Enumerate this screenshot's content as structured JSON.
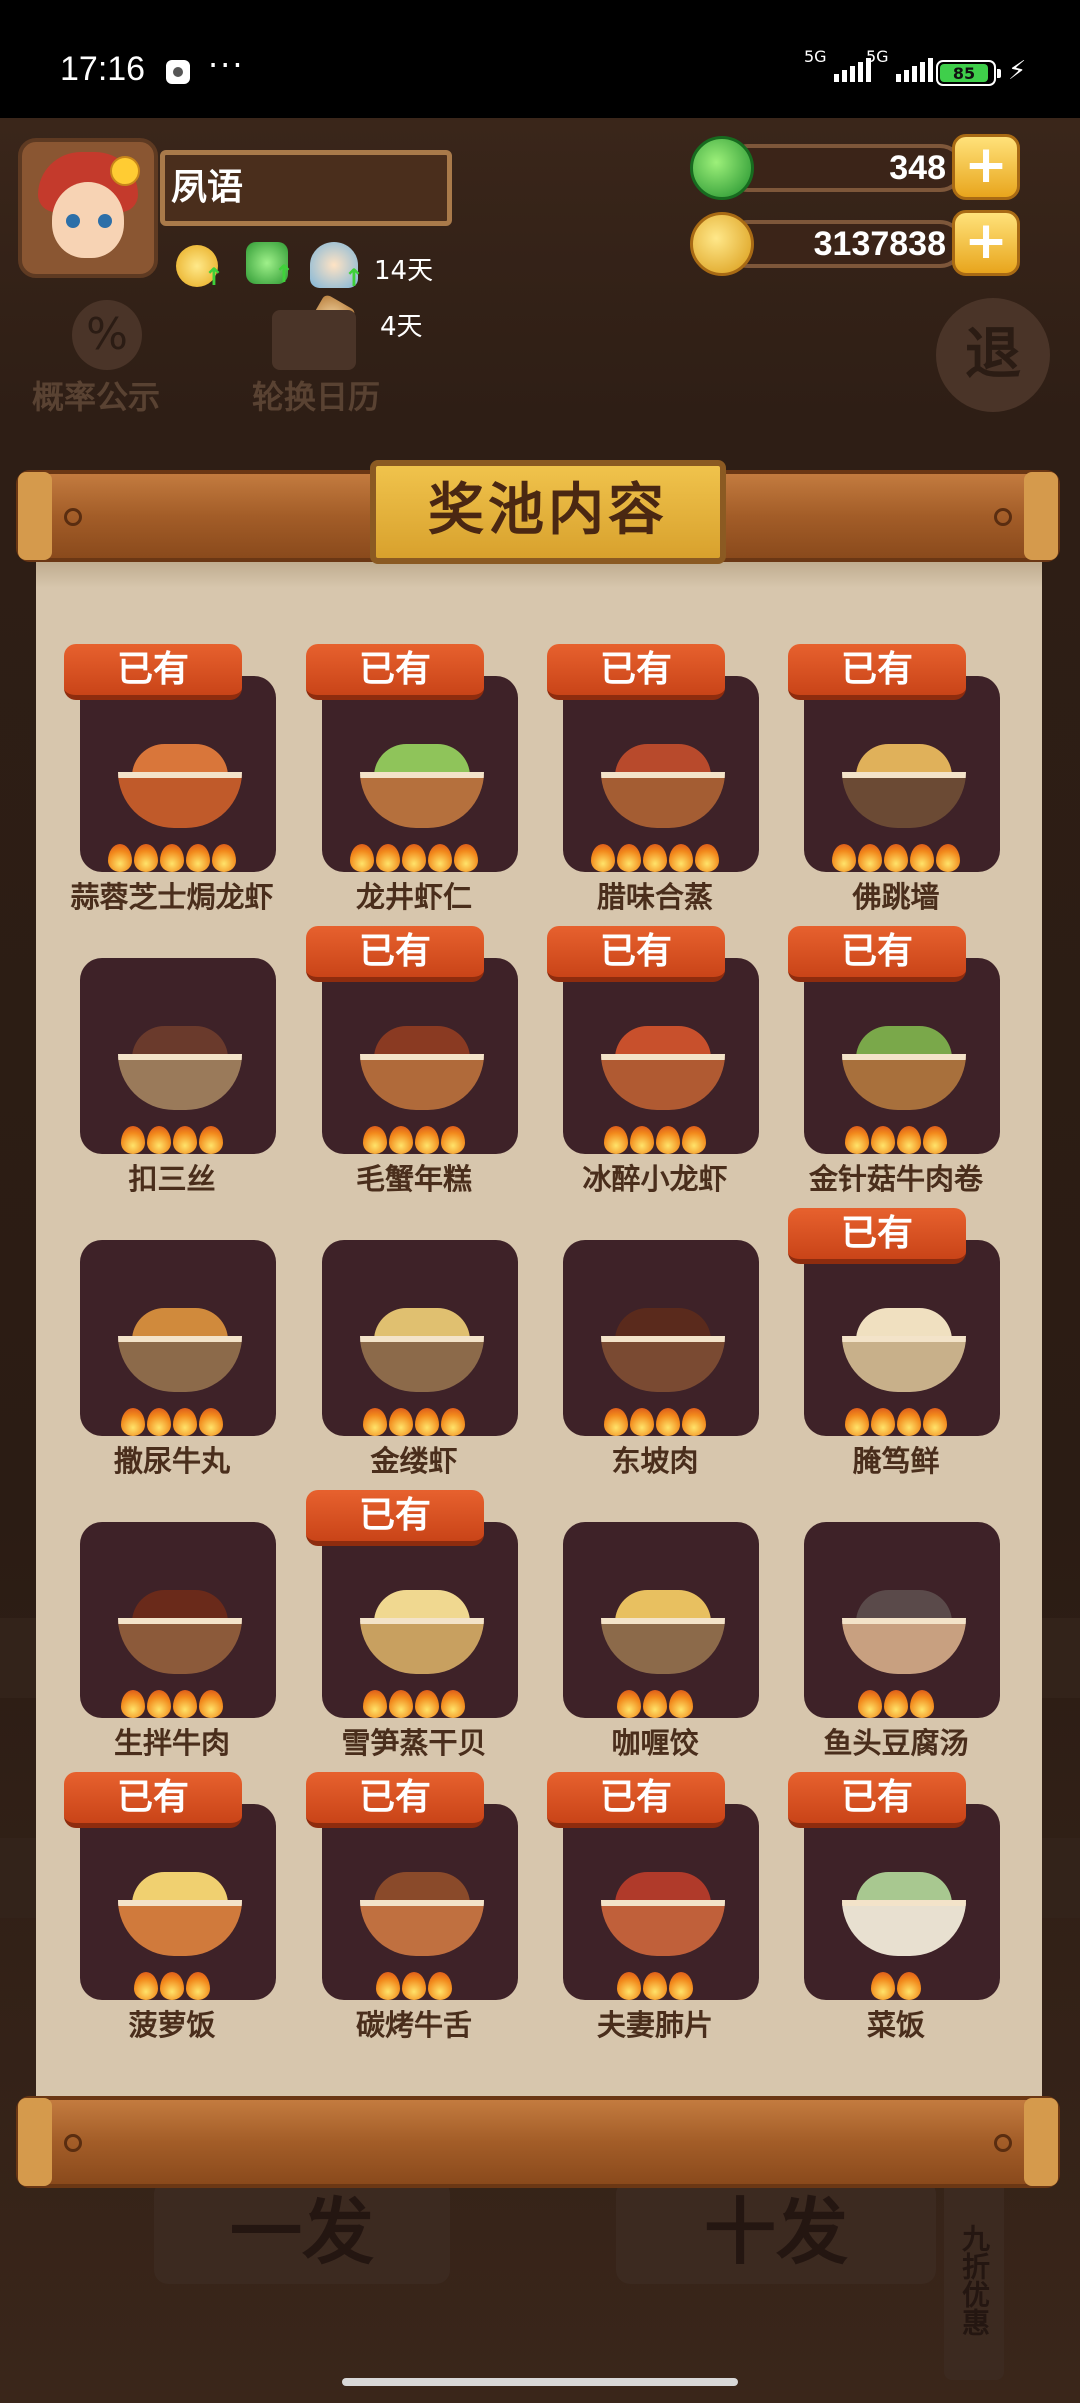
{
  "status_bar": {
    "time": "17:16",
    "dots": "···",
    "sim1": "5G",
    "sim2": "5G",
    "battery": "85"
  },
  "profile": {
    "name": "夙语",
    "buff_days_1": "14天",
    "buff_days_2": "4天"
  },
  "currency": {
    "jade": "348",
    "gold": "3137838",
    "add_symbol": "+"
  },
  "background_buttons": {
    "probability": "概率公示",
    "probability_icon": "%",
    "calendar": "轮换日历",
    "exit": "退",
    "single": "一发",
    "ten": "十发",
    "discount": "九折优惠"
  },
  "panel": {
    "title": "奖池内容",
    "owned_label": "已有"
  },
  "colors": {
    "owned_badge": "#d9521f",
    "card_bg": "#3e2228",
    "parchment": "#d7c6ad",
    "title_gold": "#e6b23c"
  },
  "dishes": [
    {
      "name": "蒜蓉芝士焗龙虾",
      "owned": true,
      "flames": 5,
      "icon": "lobster-dish-icon"
    },
    {
      "name": "龙井虾仁",
      "owned": true,
      "flames": 5,
      "icon": "shrimp-dish-icon"
    },
    {
      "name": "腊味合蒸",
      "owned": true,
      "flames": 5,
      "icon": "cured-meat-dish-icon"
    },
    {
      "name": "佛跳墙",
      "owned": true,
      "flames": 5,
      "icon": "soup-pot-icon"
    },
    {
      "name": "扣三丝",
      "owned": false,
      "flames": 4,
      "icon": "dome-dish-icon"
    },
    {
      "name": "毛蟹年糕",
      "owned": true,
      "flames": 4,
      "icon": "crab-dish-icon"
    },
    {
      "name": "冰醉小龙虾",
      "owned": true,
      "flames": 4,
      "icon": "crayfish-dish-icon"
    },
    {
      "name": "金针菇牛肉卷",
      "owned": true,
      "flames": 4,
      "icon": "beef-roll-dish-icon"
    },
    {
      "name": "撒尿牛丸",
      "owned": false,
      "flames": 4,
      "icon": "meatball-dish-icon"
    },
    {
      "name": "金缕虾",
      "owned": false,
      "flames": 4,
      "icon": "fried-shrimp-dish-icon"
    },
    {
      "name": "东坡肉",
      "owned": false,
      "flames": 4,
      "icon": "braised-pork-dish-icon"
    },
    {
      "name": "腌笃鲜",
      "owned": true,
      "flames": 4,
      "icon": "bamboo-soup-icon"
    },
    {
      "name": "生拌牛肉",
      "owned": false,
      "flames": 4,
      "icon": "beef-dish-icon"
    },
    {
      "name": "雪笋蒸干贝",
      "owned": true,
      "flames": 4,
      "icon": "scallop-dish-icon"
    },
    {
      "name": "咖喱饺",
      "owned": false,
      "flames": 3,
      "icon": "dumpling-dish-icon"
    },
    {
      "name": "鱼头豆腐汤",
      "owned": false,
      "flames": 3,
      "icon": "fish-soup-icon"
    },
    {
      "name": "菠萝饭",
      "owned": true,
      "flames": 3,
      "icon": "pineapple-rice-icon"
    },
    {
      "name": "碳烤牛舌",
      "owned": true,
      "flames": 3,
      "icon": "grilled-tongue-icon"
    },
    {
      "name": "夫妻肺片",
      "owned": true,
      "flames": 3,
      "icon": "sliced-beef-dish-icon"
    },
    {
      "name": "菜饭",
      "owned": true,
      "flames": 2,
      "icon": "vegetable-rice-icon"
    }
  ]
}
